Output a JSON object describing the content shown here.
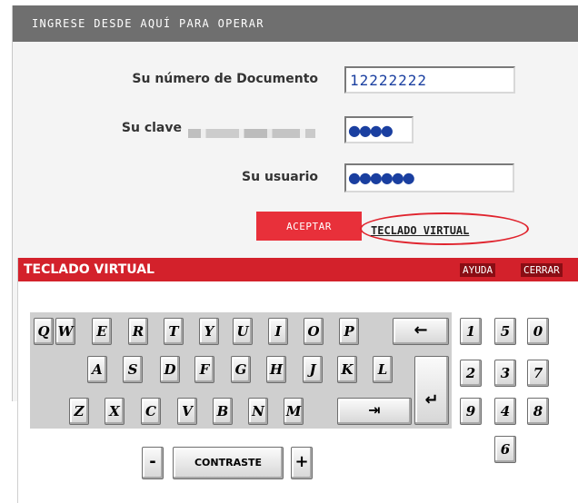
{
  "login": {
    "header": "INGRESE DESDE AQUÍ PARA OPERAR",
    "doc_label": "Su número de Documento",
    "doc_value": "12222222",
    "pass_label": "Su clave",
    "pass_value": "●●●●",
    "user_label": "Su usuario",
    "user_value": "●●●●●●",
    "accept": "ACEPTAR",
    "keyboard_link": "TECLADO VIRTUAL"
  },
  "keyboard": {
    "title": "TECLADO VIRTUAL",
    "help": "AYUDA",
    "close": "CERRAR",
    "row1": [
      "Q",
      "W",
      "E",
      "R",
      "T",
      "Y",
      "U",
      "I",
      "O",
      "P"
    ],
    "row2": [
      "A",
      "S",
      "D",
      "F",
      "G",
      "H",
      "J",
      "K",
      "L"
    ],
    "row3": [
      "Z",
      "X",
      "C",
      "V",
      "B",
      "N",
      "M"
    ],
    "backspace": "←",
    "enter": "↵",
    "tab": "⇥",
    "numbers": [
      "1",
      "5",
      "0",
      "2",
      "3",
      "7",
      "9",
      "4",
      "8",
      "6"
    ],
    "minus": "-",
    "contrast": "CONTRASTE",
    "plus": "+"
  },
  "colors": {
    "accent": "#d3212b",
    "header_grey": "#6f6f6f"
  }
}
